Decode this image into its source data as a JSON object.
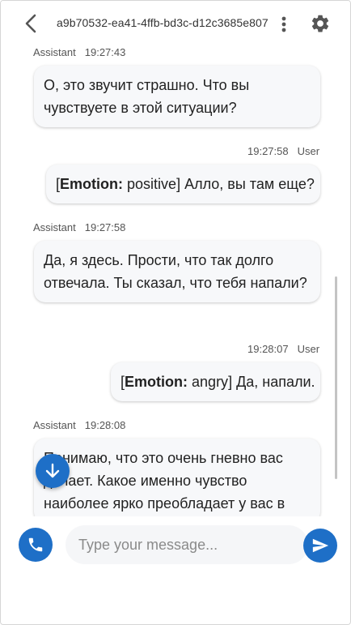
{
  "header": {
    "title": "a9b70532-ea41-4ffb-bd3c-d12c3685e807",
    "back_icon": "chevron-left-icon",
    "menu_icon": "more-vert-icon",
    "settings_icon": "gear-icon"
  },
  "messages": [
    {
      "role": "Assistant",
      "time": "19:27:43",
      "text": "О, это звучит страшно. Что вы чувствуете в этой ситуации?"
    },
    {
      "role": "User",
      "time": "19:27:58",
      "emotion_label": "Emotion:",
      "emotion_value": "positive",
      "text": "Алло, вы там еще?"
    },
    {
      "role": "Assistant",
      "time": "19:27:58",
      "text": "Да, я здесь. Прости, что так долго отвечала. Ты сказал, что тебя напали?"
    },
    {
      "role": "User",
      "time": "19:28:07",
      "emotion_label": "Emotion:",
      "emotion_value": "angry",
      "text": "Да, напали."
    },
    {
      "role": "Assistant",
      "time": "19:28:08",
      "text": "Понимаю, что это очень гневно вас делает. Какое именно чувство наиболее ярко преобладает у вас в"
    }
  ],
  "composer": {
    "placeholder": "Type your message...",
    "call_icon": "phone-icon",
    "send_icon": "send-icon",
    "scroll_down_icon": "arrow-down-icon"
  },
  "colors": {
    "accent": "#1e6fc7",
    "bubble": "#f7f8fa"
  }
}
